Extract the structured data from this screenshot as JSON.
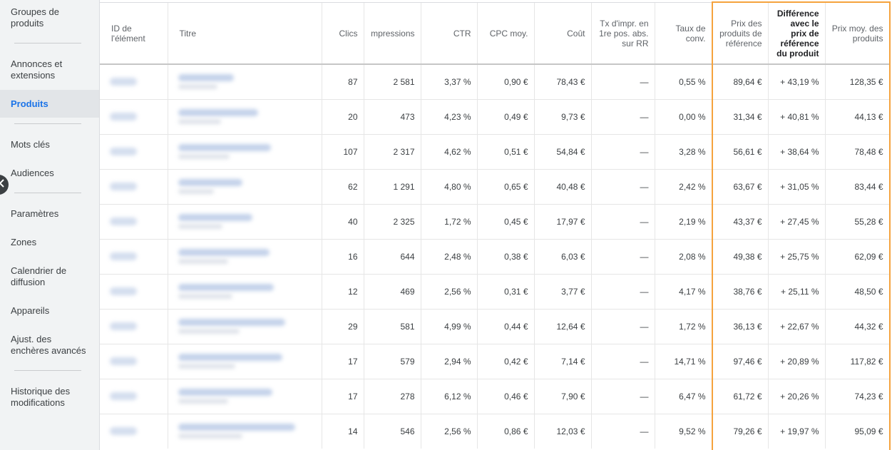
{
  "sidebar": {
    "items": [
      {
        "label": "Groupes de produits"
      },
      {
        "label": "Annonces et extensions"
      },
      {
        "label": "Produits"
      },
      {
        "label": "Mots clés"
      },
      {
        "label": "Audiences"
      },
      {
        "label": "Paramètres"
      },
      {
        "label": "Zones"
      },
      {
        "label": "Calendrier de diffusion"
      },
      {
        "label": "Appareils"
      },
      {
        "label": "Ajust. des enchères avancés"
      },
      {
        "label": "Historique des modifications"
      }
    ],
    "active": "Produits",
    "active_color": "#1a73e8"
  },
  "table": {
    "headers": {
      "id": "ID de l'élément",
      "title": "Titre",
      "clicks": "Clics",
      "impressions": "mpressions",
      "ctr": "CTR",
      "cpc": "CPC moy.",
      "cost": "Coût",
      "top_impr": "Tx d'impr. en 1re pos. abs. sur RR",
      "conv_rate": "Taux de conv.",
      "benchmark_price": "Prix des produits de référence",
      "benchmark_diff": "Différence avec le prix de référence du produit",
      "avg_price": "Prix moy. des produits"
    },
    "rows": [
      {
        "clicks": "87",
        "impressions": "2 581",
        "ctr": "3,37 %",
        "cpc": "0,90 €",
        "cost": "78,43 €",
        "top_impr": "—",
        "conv_rate": "0,55 %",
        "benchmark_price": "89,64 €",
        "benchmark_diff": "+ 43,19 %",
        "avg_price": "128,35 €"
      },
      {
        "clicks": "20",
        "impressions": "473",
        "ctr": "4,23 %",
        "cpc": "0,49 €",
        "cost": "9,73 €",
        "top_impr": "—",
        "conv_rate": "0,00 %",
        "benchmark_price": "31,34 €",
        "benchmark_diff": "+ 40,81 %",
        "avg_price": "44,13 €"
      },
      {
        "clicks": "107",
        "impressions": "2 317",
        "ctr": "4,62 %",
        "cpc": "0,51 €",
        "cost": "54,84 €",
        "top_impr": "—",
        "conv_rate": "3,28 %",
        "benchmark_price": "56,61 €",
        "benchmark_diff": "+ 38,64 %",
        "avg_price": "78,48 €"
      },
      {
        "clicks": "62",
        "impressions": "1 291",
        "ctr": "4,80 %",
        "cpc": "0,65 €",
        "cost": "40,48 €",
        "top_impr": "—",
        "conv_rate": "2,42 %",
        "benchmark_price": "63,67 €",
        "benchmark_diff": "+ 31,05 %",
        "avg_price": "83,44 €"
      },
      {
        "clicks": "40",
        "impressions": "2 325",
        "ctr": "1,72 %",
        "cpc": "0,45 €",
        "cost": "17,97 €",
        "top_impr": "—",
        "conv_rate": "2,19 %",
        "benchmark_price": "43,37 €",
        "benchmark_diff": "+ 27,45 %",
        "avg_price": "55,28 €"
      },
      {
        "clicks": "16",
        "impressions": "644",
        "ctr": "2,48 %",
        "cpc": "0,38 €",
        "cost": "6,03 €",
        "top_impr": "—",
        "conv_rate": "2,08 %",
        "benchmark_price": "49,38 €",
        "benchmark_diff": "+ 25,75 %",
        "avg_price": "62,09 €"
      },
      {
        "clicks": "12",
        "impressions": "469",
        "ctr": "2,56 %",
        "cpc": "0,31 €",
        "cost": "3,77 €",
        "top_impr": "—",
        "conv_rate": "4,17 %",
        "benchmark_price": "38,76 €",
        "benchmark_diff": "+ 25,11 %",
        "avg_price": "48,50 €"
      },
      {
        "clicks": "29",
        "impressions": "581",
        "ctr": "4,99 %",
        "cpc": "0,44 €",
        "cost": "12,64 €",
        "top_impr": "—",
        "conv_rate": "1,72 %",
        "benchmark_price": "36,13 €",
        "benchmark_diff": "+ 22,67 %",
        "avg_price": "44,32 €"
      },
      {
        "clicks": "17",
        "impressions": "579",
        "ctr": "2,94 %",
        "cpc": "0,42 €",
        "cost": "7,14 €",
        "top_impr": "—",
        "conv_rate": "14,71 %",
        "benchmark_price": "97,46 €",
        "benchmark_diff": "+ 20,89 %",
        "avg_price": "117,82 €"
      },
      {
        "clicks": "17",
        "impressions": "278",
        "ctr": "6,12 %",
        "cpc": "0,46 €",
        "cost": "7,90 €",
        "top_impr": "—",
        "conv_rate": "6,47 %",
        "benchmark_price": "61,72 €",
        "benchmark_diff": "+ 20,26 %",
        "avg_price": "74,23 €"
      },
      {
        "clicks": "14",
        "impressions": "546",
        "ctr": "2,56 %",
        "cpc": "0,86 €",
        "cost": "12,03 €",
        "top_impr": "—",
        "conv_rate": "9,52 %",
        "benchmark_price": "79,26 €",
        "benchmark_diff": "+ 19,97 %",
        "avg_price": "95,09 €"
      }
    ]
  },
  "icons": {
    "collapse": "chevron-left-icon"
  },
  "highlight_color": "#f5a33d"
}
